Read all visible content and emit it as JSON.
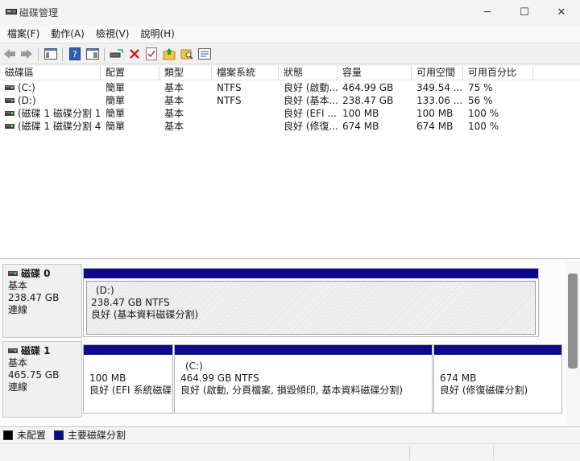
{
  "window": {
    "title": "磁碟管理",
    "minimize_glyph": "─",
    "maximize_glyph": "☐",
    "close_glyph": "✕"
  },
  "menu": [
    "檔案(F)",
    "動作(A)",
    "檢視(V)",
    "說明(H)"
  ],
  "toolbar": {
    "icons": [
      "back-arrow-icon",
      "forward-arrow-icon",
      "console-tree-icon",
      "help-icon",
      "show-pane-icon",
      "connect-disk-icon",
      "delete-icon",
      "properties-check-icon",
      "refresh-folder-icon",
      "search-folder-icon",
      "settings-list-icon"
    ]
  },
  "volumes": {
    "columns": [
      "磁碟區",
      "配置",
      "類型",
      "檔案系統",
      "狀態",
      "容量",
      "可用空間",
      "可用百分比"
    ],
    "rows": [
      {
        "name": "(C:)",
        "layout": "簡單",
        "type": "基本",
        "fs": "NTFS",
        "status": "良好 (啟動...",
        "capacity": "464.99 GB",
        "free": "349.54 ...",
        "pct": "75 %"
      },
      {
        "name": "(D:)",
        "layout": "簡單",
        "type": "基本",
        "fs": "NTFS",
        "status": "良好 (基本...",
        "capacity": "238.47 GB",
        "free": "133.06 ...",
        "pct": "56 %"
      },
      {
        "name": "(磁碟 1 磁碟分割 1)",
        "layout": "簡單",
        "type": "基本",
        "fs": "",
        "status": "良好 (EFI ...",
        "capacity": "100 MB",
        "free": "100 MB",
        "pct": "100 %"
      },
      {
        "name": "(磁碟 1 磁碟分割 4)",
        "layout": "簡單",
        "type": "基本",
        "fs": "",
        "status": "良好 (修復...",
        "capacity": "674 MB",
        "free": "674 MB",
        "pct": "100 %"
      }
    ]
  },
  "disks": [
    {
      "title": "磁碟 0",
      "type": "基本",
      "size": "238.47 GB",
      "state": "連線",
      "partitions": [
        {
          "label": "(D:)",
          "size": "238.47 GB NTFS",
          "status": "良好 (基本資料磁碟分割)"
        }
      ]
    },
    {
      "title": "磁碟 1",
      "type": "基本",
      "size": "465.75 GB",
      "state": "連線",
      "partitions": [
        {
          "label": "",
          "size": "100 MB",
          "status": "良好 (EFI 系統磁碟分"
        },
        {
          "label": "(C:)",
          "size": "464.99 GB NTFS",
          "status": "良好 (啟動, 分頁檔案, 損毀傾印, 基本資料磁碟分割)"
        },
        {
          "label": "",
          "size": "674 MB",
          "status": "良好 (修復磁碟分割)"
        }
      ]
    }
  ],
  "legend": [
    {
      "label": "未配置",
      "color": "#000000"
    },
    {
      "label": "主要磁碟分割",
      "color": "#0a0a8a"
    }
  ]
}
